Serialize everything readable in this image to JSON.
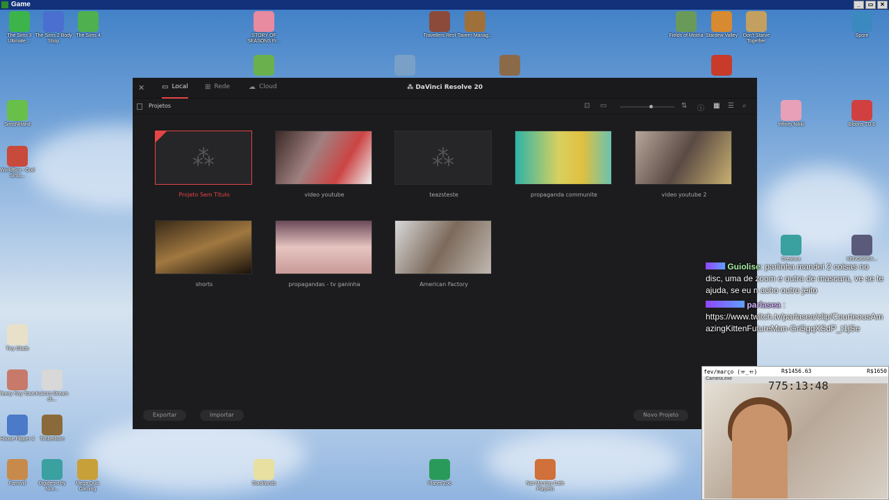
{
  "window": {
    "title": "Game",
    "minimize": "_",
    "maximize": "▭",
    "close": "✕"
  },
  "desktop_icons": [
    {
      "label": "The Sims 3 Ultimate ...",
      "color": "#3cb44b"
    },
    {
      "label": "The Sims 2 Body Shop",
      "color": "#4a6fd0"
    },
    {
      "label": "The Sims 4",
      "color": "#4fb04f"
    },
    {
      "label": "STORY OF SEASONS Fr...",
      "color": "#e88aa0"
    },
    {
      "label": "Travellers Rest",
      "color": "#8b4a3a"
    },
    {
      "label": "Tavern Manag...",
      "color": "#a0703a"
    },
    {
      "label": "Fields of Mistria",
      "color": "#6a9a5a"
    },
    {
      "label": "Stardew Valley",
      "color": "#d88a30"
    },
    {
      "label": "Don't Starve Together",
      "color": "#c4a060"
    },
    {
      "label": "Spore",
      "color": "#3a8ac0"
    },
    {
      "label": "",
      "color": "#6ab04c"
    },
    {
      "label": "",
      "color": "#7aa0c8"
    },
    {
      "label": "",
      "color": "#8b6a4a"
    },
    {
      "label": "",
      "color": "#c83a2a"
    },
    {
      "label": "SimsNHand",
      "color": "#68c04a"
    },
    {
      "label": "WorldBox - God Sima...",
      "color": "#c84a3a"
    },
    {
      "label": "Infinity Nikki",
      "color": "#e8a0b8"
    },
    {
      "label": "Bloons TD 6",
      "color": "#d04040"
    },
    {
      "label": "Creatura",
      "color": "#3aa0a0"
    },
    {
      "label": "XENOBREA...",
      "color": "#5a5a7a"
    },
    {
      "label": "Tiny Glade",
      "color": "#e8e0c8"
    },
    {
      "label": "Teeny Tiny Town",
      "color": "#c87a6a"
    },
    {
      "label": "Kukoro Stream ch...",
      "color": "#d8d8d8"
    },
    {
      "label": "House Flipper 2",
      "color": "#4a7ac8"
    },
    {
      "label": "Timberborn",
      "color": "#8a6a3a"
    },
    {
      "label": "Farmvill",
      "color": "#c88a4a"
    },
    {
      "label": "Digidemo by Nuri...",
      "color": "#3aa0a0"
    },
    {
      "label": "Mega Quiz Gaming",
      "color": "#c8a03a"
    },
    {
      "label": "Stacklands",
      "color": "#e8e0a0"
    },
    {
      "label": "Planet Zoo",
      "color": "#2a9a5a"
    },
    {
      "label": "Not Monday Cafe Playtest",
      "color": "#d0703a"
    }
  ],
  "resolve": {
    "title": "DaVinci Resolve 20",
    "tabs": [
      {
        "label": "Local",
        "icon": "laptop-icon"
      },
      {
        "label": "Rede",
        "icon": "network-icon"
      },
      {
        "label": "Cloud",
        "icon": "cloud-icon"
      }
    ],
    "section": "Projetos",
    "projects": [
      {
        "name": "Projeto Sem Título",
        "thumb": "placeholder",
        "selected": true
      },
      {
        "name": "video youtube",
        "thumb": "image"
      },
      {
        "name": "teazsteste",
        "thumb": "placeholder"
      },
      {
        "name": "propaganda communite",
        "thumb": "image"
      },
      {
        "name": "video youtube 2",
        "thumb": "image"
      },
      {
        "name": "shorts",
        "thumb": "image"
      },
      {
        "name": "propagandas - tv ganinha",
        "thumb": "image"
      },
      {
        "name": "American Factory",
        "thumb": "image"
      }
    ],
    "buttons": {
      "export": "Exportar",
      "import": "Importar",
      "new_project": "Novo Projeto"
    }
  },
  "chat": {
    "msg1_user": "Guiolise",
    "msg1_text": ": parlinha mandei 2 coisas no disc, uma de zoom e outra de mascara, ve se te ajuda, se eu n acho outro jeito",
    "msg2_user": "parlasea",
    "msg2_text": "https://www.twitch.tv/parlasea/clip/CourteousAmazingKittenFutureMan-Gri5gqXSdP_t1jSe"
  },
  "overlay": {
    "goal_label": "fev/março (ㅠ_ㅠ)",
    "current": "R$1456.63",
    "target": "R$1650",
    "camera_window": "Camera.exe",
    "timer": "775:13:48"
  }
}
